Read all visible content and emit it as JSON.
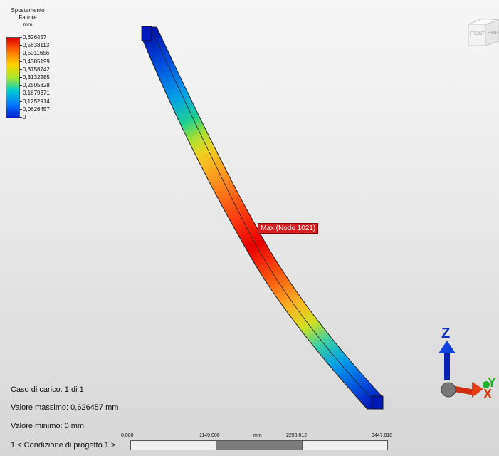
{
  "legend": {
    "title_lines": [
      "Spostamento",
      "Fattore",
      "mm"
    ],
    "values": [
      "0,626457",
      "0,5638113",
      "0,5011656",
      "0,4385199",
      "0,3758742",
      "0,3132285",
      "0,2505828",
      "0,1879371",
      "0,1252914",
      "0,0626457",
      "0"
    ]
  },
  "viewcube": {
    "front": "FRONT",
    "right": "RIGH"
  },
  "max_marker": "Max (Nodo 1021)",
  "info": {
    "load_case": "Caso di carico: 1 di 1",
    "max_value": "Valore massimo: 0,626457 mm",
    "min_value": "Valore minimo: 0 mm"
  },
  "load_case_nav": "1 < Condizione di progetto 1 >",
  "ruler": {
    "labels": [
      "0,000",
      "1149,006",
      "mm",
      "2298,012",
      "3447,018"
    ]
  },
  "triad": {
    "z": "Z",
    "y": "Y",
    "x": "X"
  }
}
